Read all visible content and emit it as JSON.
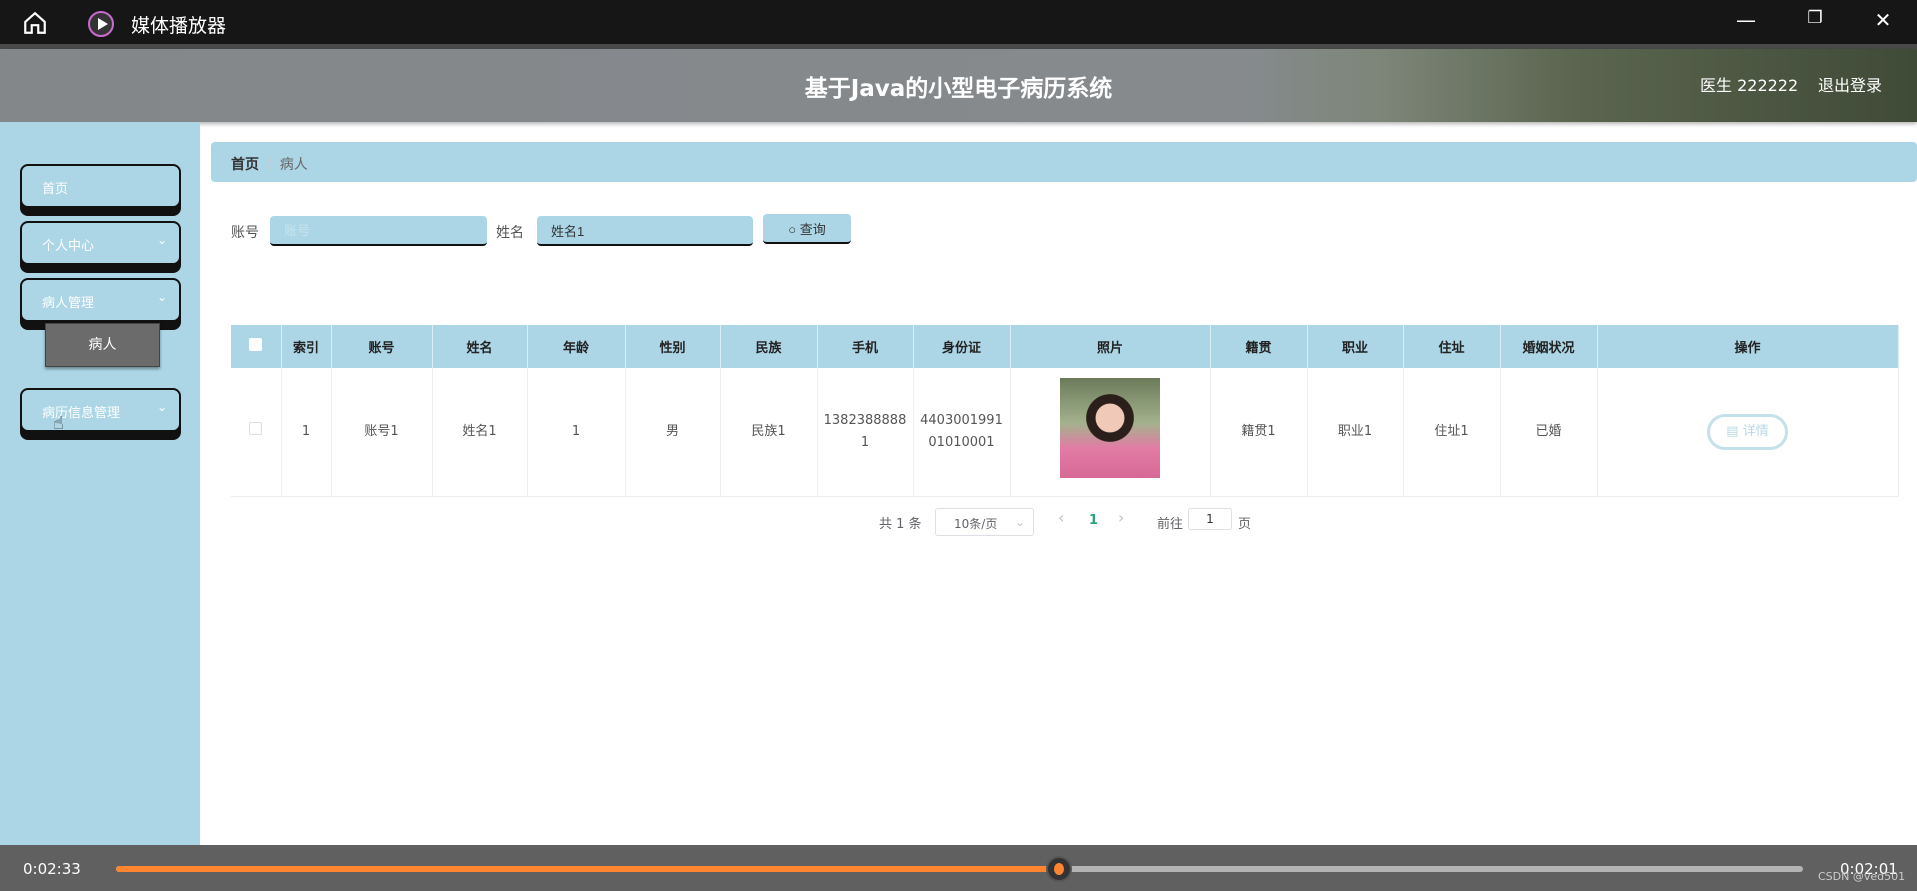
{
  "window": {
    "app_title": "媒体播放器",
    "minimize": "—",
    "restore": "❐",
    "close": "✕"
  },
  "header": {
    "title": "基于Java的小型电子病历系统",
    "user": "医生 222222",
    "logout": "退出登录"
  },
  "sidebar": {
    "items": [
      {
        "label": "首页"
      },
      {
        "label": "个人中心",
        "chevron": "⌄"
      },
      {
        "label": "病人管理",
        "chevron": "⌄"
      },
      {
        "label": "病历信息管理",
        "chevron": "⌄"
      }
    ],
    "subitem": "病人"
  },
  "breadcrumb": {
    "home": "首页",
    "current": "病人",
    "sep": "/"
  },
  "search": {
    "account_label": "账号",
    "account_placeholder": "账号",
    "account_value": "",
    "name_label": "姓名",
    "name_value": "姓名1",
    "button": "查询",
    "button_icon": "search-icon"
  },
  "table": {
    "headers": [
      "索引",
      "账号",
      "姓名",
      "年龄",
      "性别",
      "民族",
      "手机",
      "身份证",
      "照片",
      "籍贯",
      "职业",
      "住址",
      "婚姻状况",
      "操作"
    ],
    "rows": [
      {
        "index": "1",
        "account": "账号1",
        "name": "姓名1",
        "age": "1",
        "gender": "男",
        "ethnicity": "民族1",
        "phone": "13823888881",
        "id_card": "440300199101010001",
        "hometown": "籍贯1",
        "job": "职业1",
        "address": "住址1",
        "marital": "已婚",
        "action": "详情"
      }
    ]
  },
  "pagination": {
    "total": "共 1 条",
    "page_size": "10条/页",
    "current_page": "1",
    "goto_label": "前往",
    "goto_value": "1",
    "page_suffix": "页",
    "prev": "‹",
    "next": "›"
  },
  "player": {
    "elapsed": "0:02:33",
    "remaining": "0:02:01",
    "progress": 0.559,
    "accent": "#ff8530",
    "watermark": "CSDN @ved501"
  }
}
